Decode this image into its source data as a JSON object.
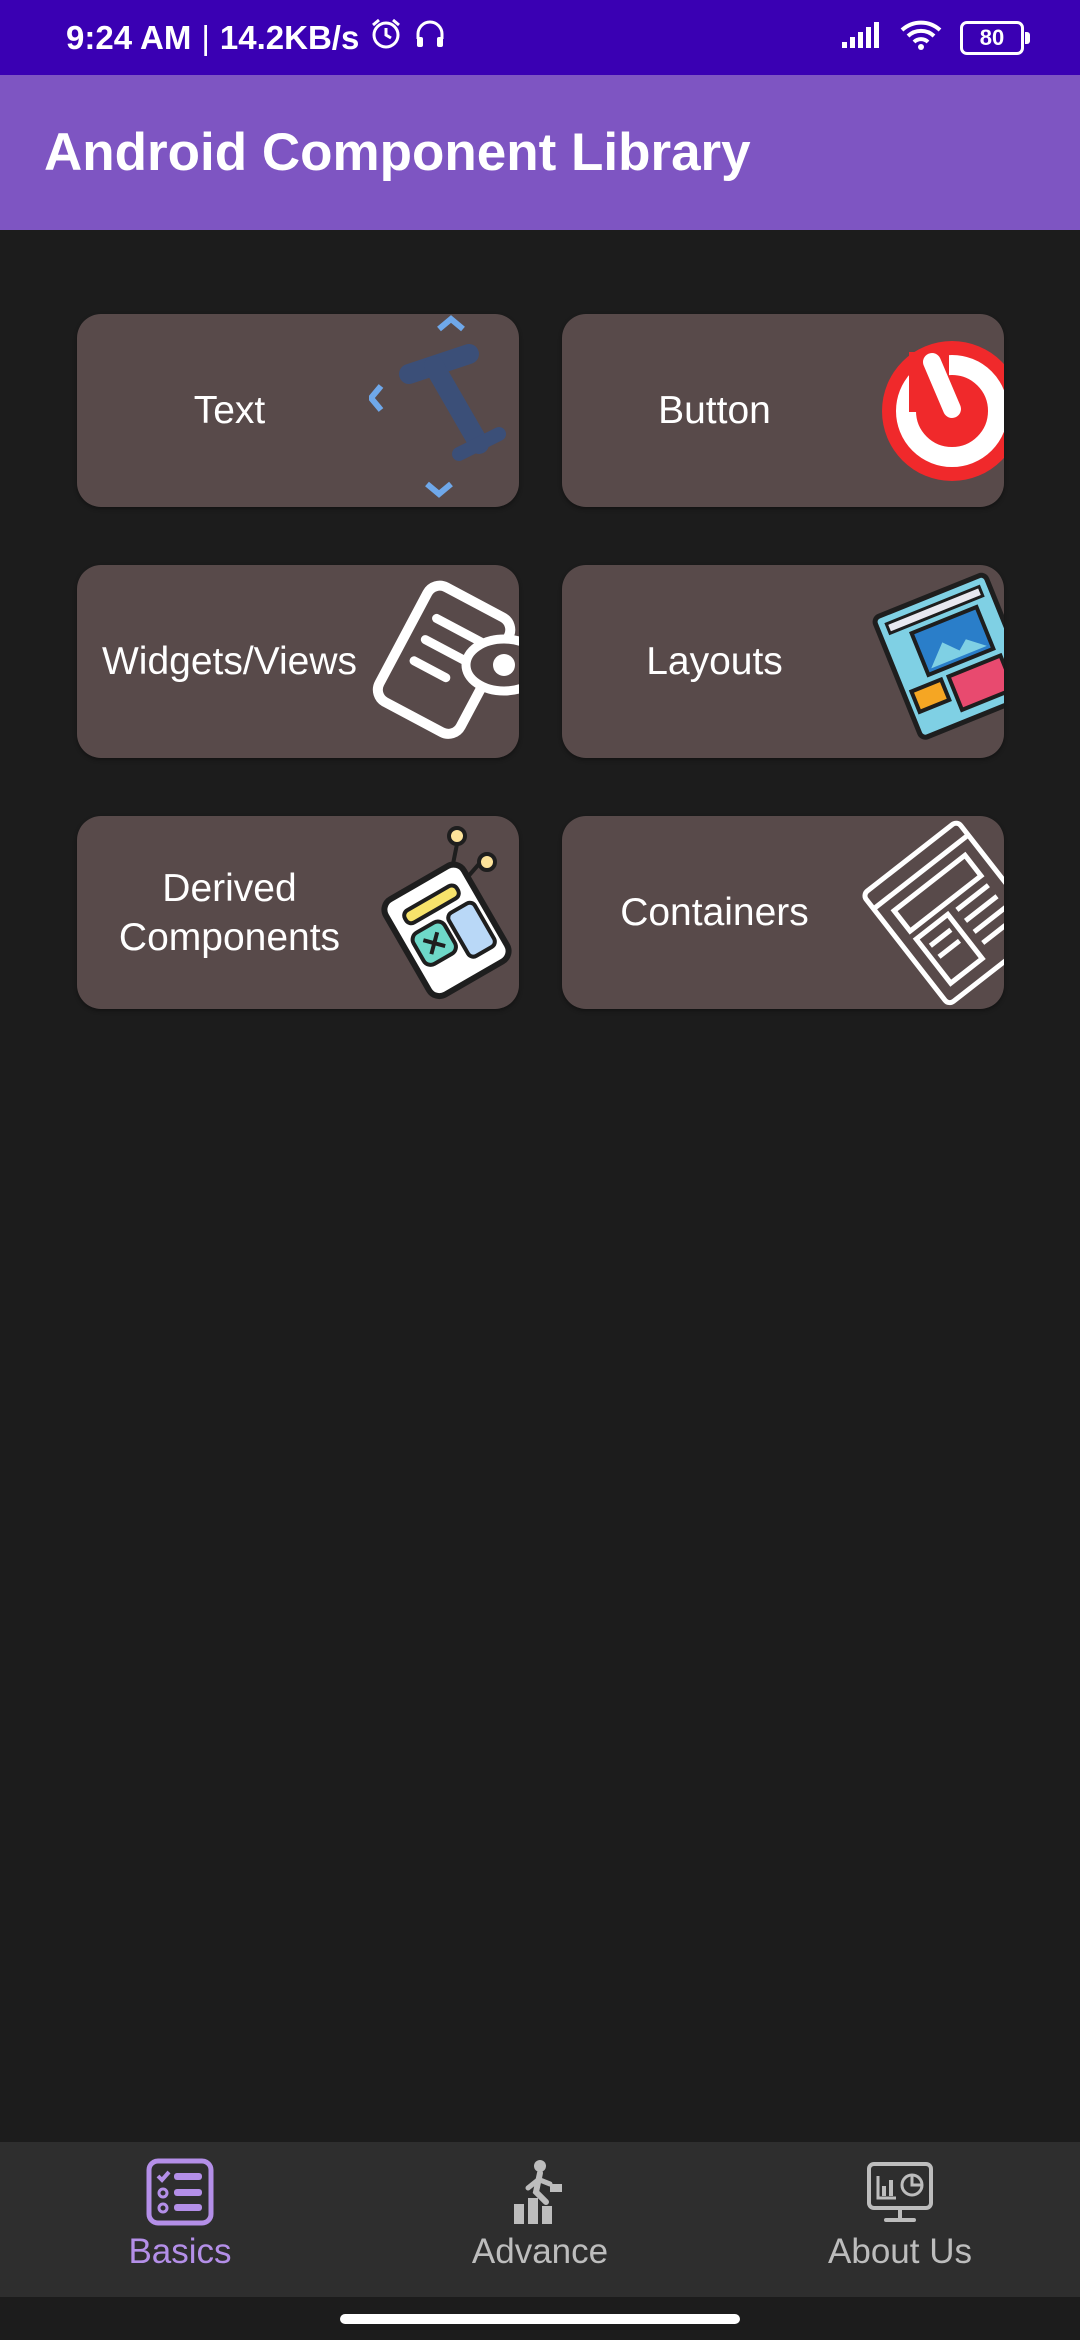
{
  "status_bar": {
    "time": "9:24 AM",
    "separator": "|",
    "speed": "14.2KB/s",
    "battery": "80",
    "icons": [
      "alarm-icon",
      "headset-icon",
      "signal-icon",
      "wifi-icon",
      "battery-icon"
    ]
  },
  "app_bar": {
    "title": "Android Component Library"
  },
  "cards": [
    {
      "label": "Text",
      "icon": "text-format-icon"
    },
    {
      "label": "Button",
      "icon": "power-button-icon"
    },
    {
      "label": "Widgets/Views",
      "icon": "document-view-icon"
    },
    {
      "label": "Layouts",
      "icon": "layout-icon"
    },
    {
      "label": "Derived\nComponents",
      "icon": "components-icon"
    },
    {
      "label": "Containers",
      "icon": "containers-icon"
    }
  ],
  "bottom_nav": {
    "items": [
      {
        "label": "Basics",
        "icon": "checklist-icon",
        "active": true
      },
      {
        "label": "Advance",
        "icon": "progress-person-icon",
        "active": false
      },
      {
        "label": "About Us",
        "icon": "monitor-chart-icon",
        "active": false
      }
    ]
  },
  "colors": {
    "status_bar": "#3a00b3",
    "app_bar": "#7e55c2",
    "background": "#1c1c1c",
    "card": "#584a4a",
    "nav_active": "#b48fe8",
    "nav_inactive": "#bdbdbd"
  }
}
